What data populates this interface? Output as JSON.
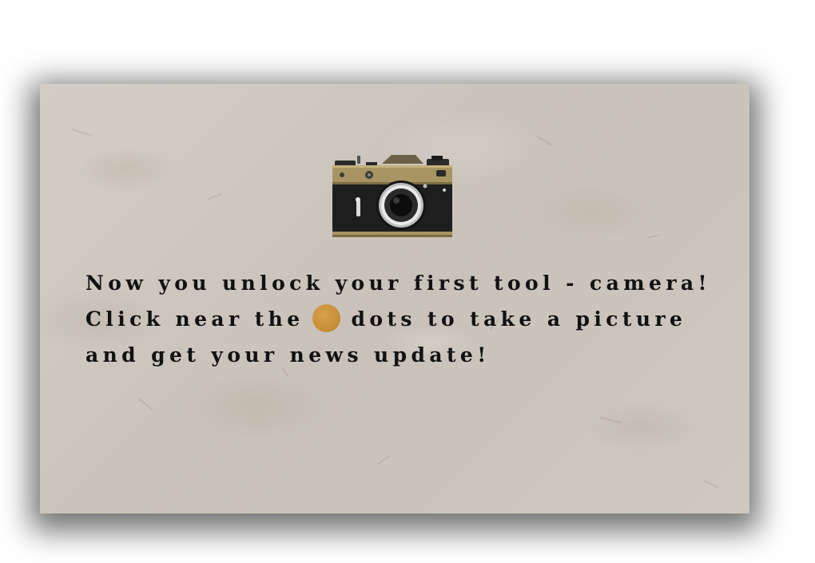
{
  "tutorial": {
    "line1": "Now you unlock your first tool - camera!",
    "line2_before": "Click near the",
    "line2_after": "dots to take a picture",
    "line3": "and get your news update!"
  },
  "icons": {
    "camera": "camera-icon",
    "dot": "orange-dot-icon"
  },
  "colors": {
    "paper": "#cfc9c2",
    "text": "#111111",
    "dot": "#c9913a",
    "camera_brass": "#a89462",
    "camera_body": "#1e1e1e"
  }
}
